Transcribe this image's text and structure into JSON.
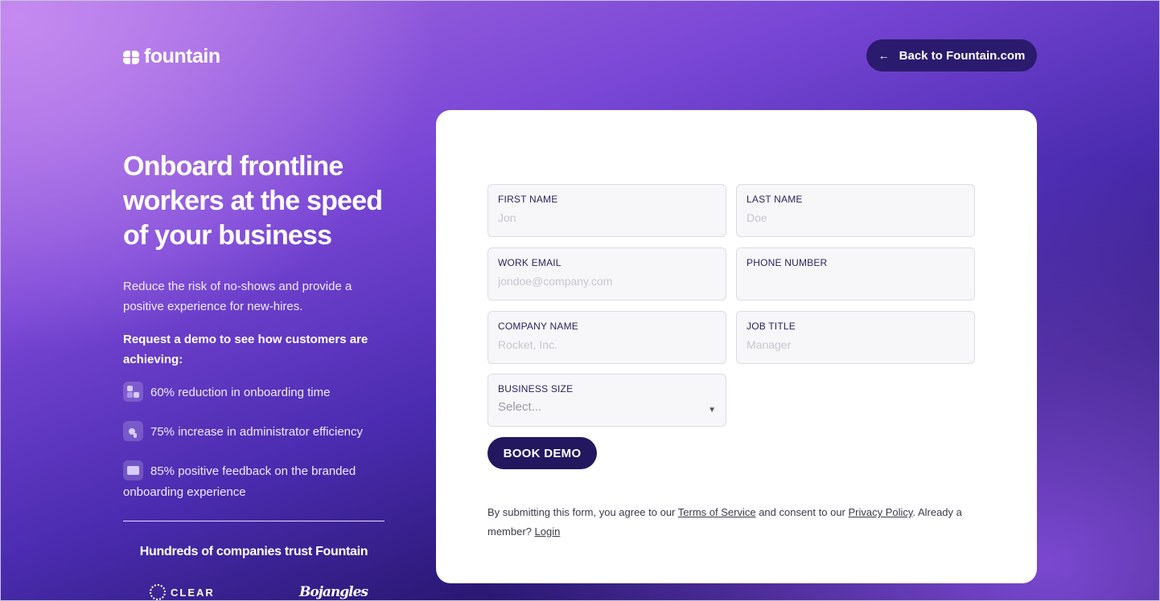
{
  "brand": {
    "name": "fountain"
  },
  "header": {
    "back_label": "Back to Fountain.com",
    "back_icon": "arrow-left-icon"
  },
  "hero": {
    "title": "Onboard frontline workers at the speed of your business",
    "subtitle": "Reduce the risk of no-shows and provide a positive experience for new-hires.",
    "request": "Request a demo to see how customers are achieving:",
    "stats": [
      {
        "icon": "grid-icon",
        "text": "60% reduction in onboarding time"
      },
      {
        "icon": "cursor-icon",
        "text": "75% increase in administrator efficiency"
      },
      {
        "icon": "card-icon",
        "text": "85% positive feedback on the branded onboarding experience"
      }
    ],
    "trust_heading": "Hundreds of companies trust Fountain",
    "customer_logos": [
      "CLEAR",
      "Bojangles"
    ]
  },
  "form": {
    "first_name": {
      "label": "FIRST NAME",
      "placeholder": "Jon",
      "value": ""
    },
    "last_name": {
      "label": "LAST NAME",
      "placeholder": "Doe",
      "value": ""
    },
    "work_email": {
      "label": "WORK EMAIL",
      "placeholder": "jondoe@company.com",
      "value": ""
    },
    "phone": {
      "label": "PHONE NUMBER",
      "placeholder": "",
      "value": ""
    },
    "company": {
      "label": "COMPANY NAME",
      "placeholder": "Rocket, Inc.",
      "value": ""
    },
    "job_title": {
      "label": "JOB TITLE",
      "placeholder": "Manager",
      "value": ""
    },
    "business_size": {
      "label": "BUSINESS SIZE",
      "selected": "Select..."
    },
    "submit_label": "BOOK DEMO",
    "legal": {
      "prefix": "By submitting this form, you agree to our ",
      "terms": "Terms of Service",
      "middle": " and consent to our ",
      "privacy": "Privacy Policy",
      "suffix": ". Already a member? ",
      "login": "Login"
    }
  },
  "colors": {
    "button": "#23175f",
    "back_button": "#2a1b6e",
    "card": "#ffffff"
  }
}
